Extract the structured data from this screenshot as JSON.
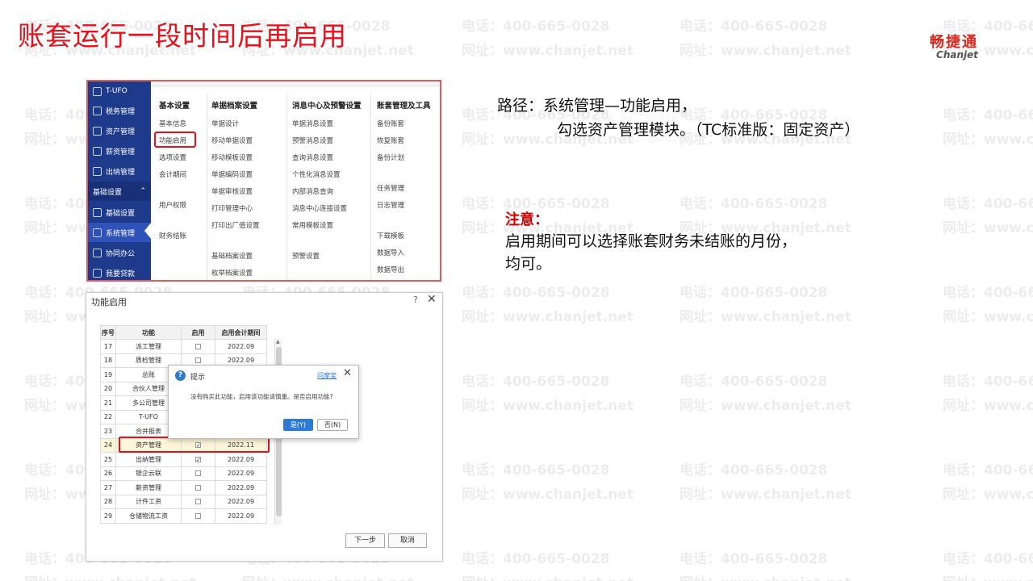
{
  "slide": {
    "title": "账套运行一段时间后再启用",
    "logo_cn": "畅捷通",
    "logo_en": "Chanjet",
    "watermark_phone": "电话：400-665-0028",
    "watermark_url": "网址：www.chanjet.net"
  },
  "nav": {
    "items": [
      {
        "label": "T-UFO",
        "icon": "report-icon"
      },
      {
        "label": "税务管理",
        "icon": "tax-icon"
      },
      {
        "label": "资产管理",
        "icon": "bank-icon"
      },
      {
        "label": "薪资管理",
        "icon": "salary-icon"
      },
      {
        "label": "出纳管理",
        "icon": "cashier-icon"
      },
      {
        "label": "基础设置",
        "icon": "chevron-up-icon"
      },
      {
        "label": "基础设置",
        "icon": "settings-icon"
      },
      {
        "label": "系统管理",
        "icon": "system-icon"
      },
      {
        "label": "协同办公",
        "icon": "collab-icon"
      },
      {
        "label": "我要贷款",
        "icon": "loan-icon"
      }
    ]
  },
  "menu": {
    "columns": [
      {
        "header": "基本设置",
        "items": [
          "基本信息",
          "功能启用",
          "选项设置",
          "会计期间",
          "用户权限",
          "财务结账"
        ]
      },
      {
        "header": "单据档案设置",
        "items": [
          "单据设计",
          "移动单据设置",
          "移动模板设置",
          "单据编码设置",
          "单据审核设置",
          "打印管理中心",
          "打印出厂值设置",
          "基础档案设置",
          "枚举档案设置"
        ]
      },
      {
        "header": "消息中心及预警设置",
        "items": [
          "单据消息设置",
          "预警消息设置",
          "查询消息设置",
          "个性化消息设置",
          "内部消息查询",
          "消息中心连接设置",
          "常用模板设置",
          "预警设置"
        ]
      },
      {
        "header": "账套管理及工具",
        "items": [
          "备份账套",
          "恢复账套",
          "备份计划",
          "任务管理",
          "日志管理",
          "下载模板",
          "数据导入",
          "数据导出"
        ]
      }
    ]
  },
  "dialog": {
    "title": "功能启用",
    "headers": [
      "序号",
      "功能",
      "启用",
      "启用会计期间"
    ],
    "rows": [
      {
        "no": "17",
        "name": "派工管理",
        "checked": false,
        "period": "2022.09"
      },
      {
        "no": "18",
        "name": "质检管理",
        "checked": false,
        "period": "2022.09"
      },
      {
        "no": "19",
        "name": "总账",
        "checked": false,
        "period": ""
      },
      {
        "no": "20",
        "name": "合伙人管理",
        "checked": false,
        "period": ""
      },
      {
        "no": "21",
        "name": "多公司管理",
        "checked": false,
        "period": ""
      },
      {
        "no": "22",
        "name": "T-UFO",
        "checked": false,
        "period": ""
      },
      {
        "no": "23",
        "name": "合并报表",
        "checked": false,
        "period": ""
      },
      {
        "no": "24",
        "name": "资产管理",
        "checked": true,
        "period": "2022.11"
      },
      {
        "no": "25",
        "name": "出纳管理",
        "checked": true,
        "period": "2022.09"
      },
      {
        "no": "26",
        "name": "银企云联",
        "checked": false,
        "period": "2022.09"
      },
      {
        "no": "27",
        "name": "薪资管理",
        "checked": false,
        "period": "2022.09"
      },
      {
        "no": "28",
        "name": "计件工资",
        "checked": false,
        "period": "2022.09"
      },
      {
        "no": "29",
        "name": "仓储物流工资",
        "checked": false,
        "period": "2022.09"
      }
    ],
    "next_label": "下一步",
    "cancel_label": "取消"
  },
  "popup": {
    "title": "提示",
    "link": "问摩宝",
    "message": "没有购买此功能，启用该功能请慎重。是否启用功能?",
    "yes_label": "是(Y)",
    "no_label": "否(N)"
  },
  "text": {
    "path_line1": "路径：系统管理—功能启用，",
    "path_line2": "勾选资产管理模块。（TC标准版：固定资产）",
    "note_title": "注意：",
    "note_line1": "启用期间可以选择账套财务未结账的月份，",
    "note_line2": "均可。"
  },
  "colors": {
    "title_red": "#e8101a",
    "nav_blue": "#1e3a8a",
    "accent_blue": "#2f7bd3"
  }
}
